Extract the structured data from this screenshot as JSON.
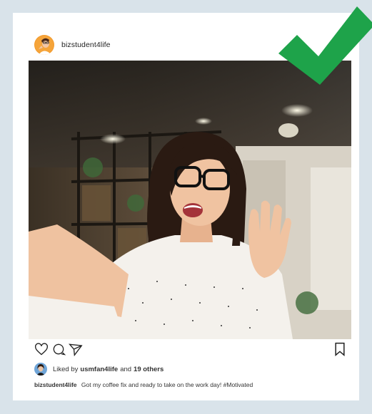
{
  "post": {
    "username": "bizstudent4life",
    "liked_prefix": "Liked by ",
    "liked_user": "usmfan4life",
    "liked_middle": " and ",
    "liked_others": "19 others",
    "caption_user": "bizstudent4life",
    "caption_text": "Got my coffee fix and ready to take on the work day! #Motivated"
  },
  "icons": {
    "like": "heart-icon",
    "comment": "comment-icon",
    "share": "send-icon",
    "save": "bookmark-icon",
    "badge": "checkmark-icon"
  },
  "colors": {
    "background": "#d9e3ea",
    "card": "#ffffff",
    "checkmark": "#1ea34a",
    "text": "#222222"
  }
}
